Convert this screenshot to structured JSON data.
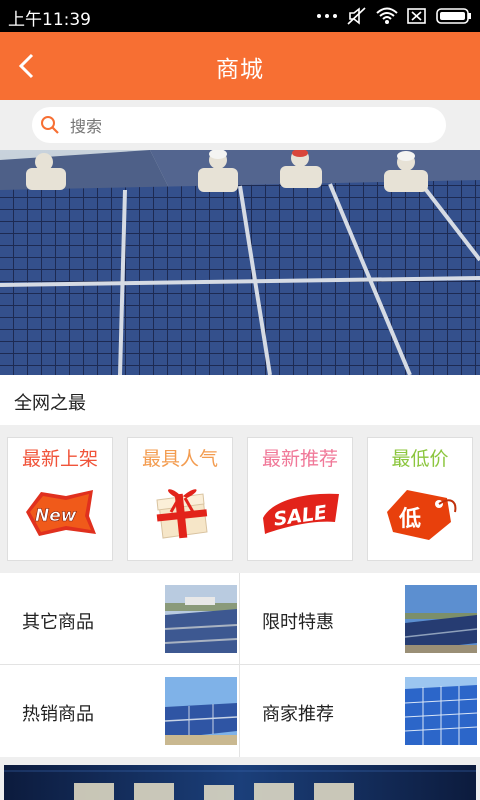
{
  "status_bar": {
    "time": "上午11:39"
  },
  "header": {
    "title": "商城"
  },
  "search": {
    "placeholder": "搜索"
  },
  "section": {
    "title": "全网之最"
  },
  "cards": [
    {
      "label": "最新上架",
      "color": "#f0543a",
      "icon": "new-badge-icon"
    },
    {
      "label": "最具人气",
      "color": "#f39c50",
      "icon": "gift-box-icon"
    },
    {
      "label": "最新推荐",
      "color": "#f07898",
      "icon": "sale-tag-icon"
    },
    {
      "label": "最低价",
      "color": "#8cc63e",
      "icon": "low-price-tag-icon"
    }
  ],
  "grid": [
    {
      "label": "其它商品"
    },
    {
      "label": "限时特惠"
    },
    {
      "label": "热销商品"
    },
    {
      "label": "商家推荐"
    }
  ],
  "colors": {
    "accent": "#f76f33",
    "background": "#efefef"
  }
}
